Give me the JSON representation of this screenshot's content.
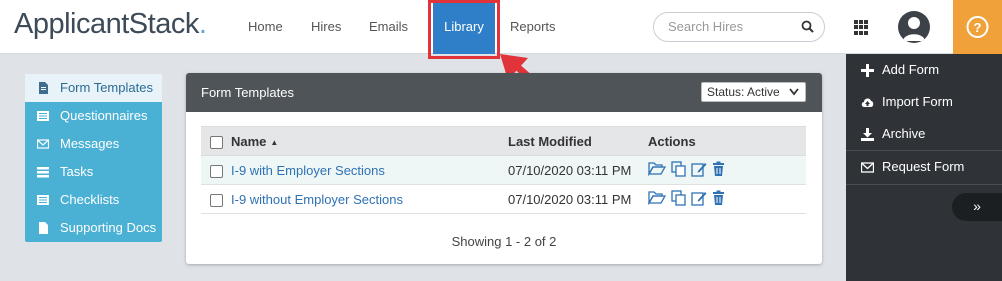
{
  "header": {
    "logo_text": "ApplicantStack",
    "logo_dot": ".",
    "nav": {
      "home": "Home",
      "hires": "Hires",
      "emails": "Emails",
      "library": "Library",
      "reports": "Reports"
    },
    "search_placeholder": "Search Hires",
    "help_label": "?"
  },
  "sidebar": {
    "items": [
      {
        "label": "Form Templates",
        "icon": "document-icon"
      },
      {
        "label": "Questionnaires",
        "icon": "list-icon"
      },
      {
        "label": "Messages",
        "icon": "envelope-icon"
      },
      {
        "label": "Tasks",
        "icon": "tasks-icon"
      },
      {
        "label": "Checklists",
        "icon": "checklist-icon"
      },
      {
        "label": "Supporting Docs",
        "icon": "file-icon"
      }
    ]
  },
  "panel": {
    "title": "Form Templates",
    "status_filter": "Status: Active",
    "columns": {
      "name": "Name",
      "modified": "Last Modified",
      "actions": "Actions"
    },
    "rows": [
      {
        "name": "I-9 with Employer Sections",
        "modified": "07/10/2020 03:11 PM"
      },
      {
        "name": "I-9 without Employer Sections",
        "modified": "07/10/2020 03:11 PM"
      }
    ],
    "showing": "Showing 1 - 2 of 2"
  },
  "right_sidebar": {
    "items": [
      {
        "label": "Add Form",
        "icon": "plus-icon"
      },
      {
        "label": "Import Form",
        "icon": "cloud-upload-icon"
      },
      {
        "label": "Archive",
        "icon": "download-icon"
      },
      {
        "label": "Request Form",
        "icon": "envelope-icon"
      }
    ],
    "collapse_label": "»"
  },
  "colors": {
    "accent_blue": "#2f7fc8",
    "sidebar_blue": "#4ab0d4",
    "help_orange": "#f0a13a",
    "highlight_red": "#e0343a",
    "dark_sidebar": "#2f3338"
  }
}
